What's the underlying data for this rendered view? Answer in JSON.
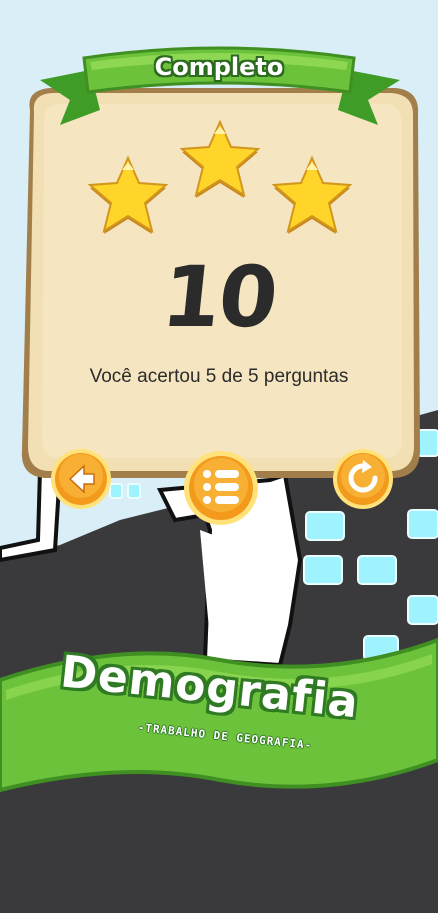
{
  "result_panel": {
    "ribbon_title": "Completo",
    "stars_earned": 3,
    "stars_total": 3,
    "score": "10",
    "result_text": "Você acertou 5 de 5 perguntas"
  },
  "buttons": {
    "back": "back-arrow-icon",
    "menu": "list-menu-icon",
    "replay": "replay-icon"
  },
  "banner": {
    "title": "Demografia",
    "subtitle": "-TRABALHO DE GEOGRAFIA-"
  },
  "colors": {
    "sky": "#d9eef6",
    "panel": "#f2dfb4",
    "ribbon_green": "#6cc23a",
    "button_orange": "#f39a1c",
    "star_yellow": "#ffd52a",
    "ground": "#3a3a3c",
    "glow_cyan": "#9ff3ff"
  }
}
